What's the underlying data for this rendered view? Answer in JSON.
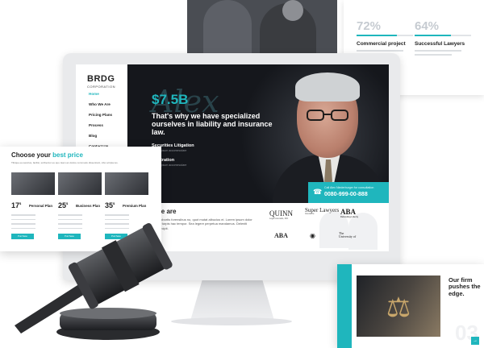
{
  "stats": [
    {
      "value": "72%",
      "label": "Commercial project",
      "fill": 0.72
    },
    {
      "value": "64%",
      "label": "Successful Lawyers",
      "fill": 0.64
    }
  ],
  "site": {
    "brand": "BRDG",
    "brand_sub": "CORPORATION",
    "nav": [
      "Home",
      "Who We Are",
      "Pricing Plans",
      "Process",
      "Blog",
      "Contact Us"
    ],
    "hero": {
      "price": "$7.5B",
      "headline": "That's why we have specialized ourselves in liability and insurance law.",
      "services": [
        {
          "title": "Securities Litigation",
          "desc": "Lorem ipsum accommodare"
        },
        {
          "title": "Arbitration",
          "desc": "Lorem ipsum accommodare"
        }
      ],
      "cta_line1": "Call Alex Niederburger for consultation",
      "cta_phone": "0080-999-00-888"
    },
    "about": {
      "heading": "Who we are",
      "text": "Lorem ipsum lobortis forensibus no, quot mutat albucius ei. Lorem ipsum dolor sit amet. Nunc turpis hac tempor. Sea legere perpetua mandamus. Deleniti disputando percipit.",
      "logos": [
        "QUINN",
        "Super Lawyers",
        "ABA"
      ]
    }
  },
  "pricing": {
    "title_main": "Choose your ",
    "title_accent": "best price",
    "description": "Tibique ea sanctus, facilisi, scribentur eu quo. Eam an dolore commodo dissentiunt, cibo scripta ius.",
    "plans": [
      {
        "amount": "17",
        "currency": "$",
        "name": "Personal Plan",
        "button": "Purchase"
      },
      {
        "amount": "25",
        "currency": "$",
        "name": "Business Plan",
        "button": "Purchase"
      },
      {
        "amount": "35",
        "currency": "$",
        "name": "Premium Plan",
        "button": "Purchase"
      }
    ]
  },
  "card": {
    "heading": "Our firm pushes the edge.",
    "bg_number": "03",
    "arrow": "→"
  },
  "colors": {
    "accent": "#1fb6bd",
    "dark": "#15171c"
  }
}
